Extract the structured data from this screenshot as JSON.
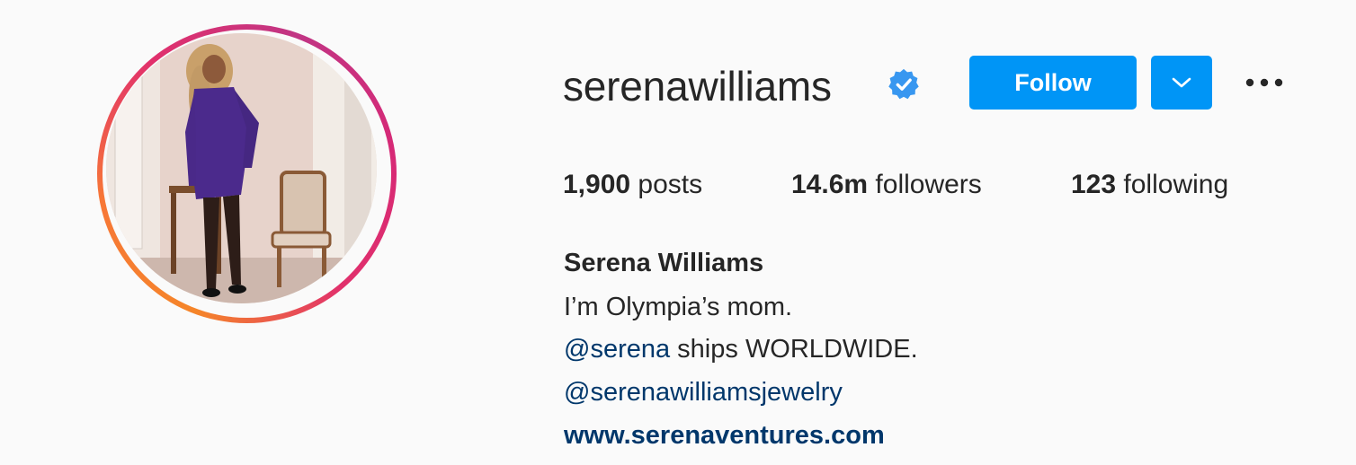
{
  "profile": {
    "username": "serenawilliams",
    "verified": true,
    "full_name": "Serena Williams",
    "bio_line1": "I’m Olympia’s mom.",
    "bio_mention1": "@serena",
    "bio_line2_rest": " ships WORLDWIDE.",
    "bio_mention2": "@serenawilliamsjewelry",
    "website": "www.serenaventures.com"
  },
  "actions": {
    "follow_label": "Follow",
    "dropdown_icon": "chevron-down-icon",
    "options_icon": "more-horizontal-icon"
  },
  "stats": {
    "posts_count": "1,900",
    "posts_label": "posts",
    "followers_count": "14.6m",
    "followers_label": "followers",
    "following_count": "123",
    "following_label": "following"
  },
  "colors": {
    "background": "#fafafa",
    "text": "#262626",
    "button_blue": "#0095f6",
    "link": "#00376b",
    "verified_blue": "#3897f0"
  }
}
